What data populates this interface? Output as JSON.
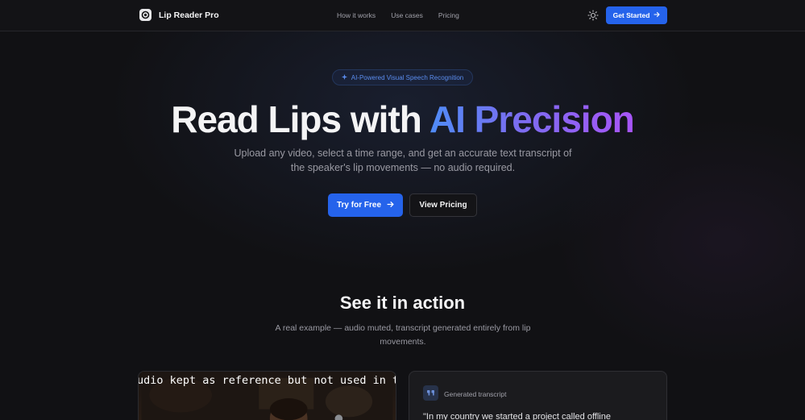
{
  "nav": {
    "brand": "Lip Reader Pro",
    "links": [
      "How it works",
      "Use cases",
      "Pricing"
    ],
    "cta": "Get Started",
    "icons": {
      "logo": "lens-logo-icon",
      "theme": "sun-icon",
      "arrow": "arrow-right-icon"
    }
  },
  "hero": {
    "badge": "AI-Powered Visual Speech Recognition",
    "title_plain": "Read Lips with ",
    "title_accent": "AI Precision",
    "subtitle": "Upload any video, select a time range, and get an accurate text transcript of the speaker's lip movements — no audio required.",
    "primary_button": "Try for Free",
    "secondary_button": "View Pricing"
  },
  "demo": {
    "title": "See it in action",
    "subtitle": "A real example — audio muted, transcript generated entirely from lip movements.",
    "video_caption": "udio kept as reference but not used in the progra",
    "transcript_label": "Generated transcript",
    "transcript_text": "\"In my country we started a project called offline"
  },
  "colors": {
    "accent": "#2563eb",
    "gradient_start": "#4f8cf6",
    "gradient_end": "#a855f7",
    "background": "#111114"
  }
}
